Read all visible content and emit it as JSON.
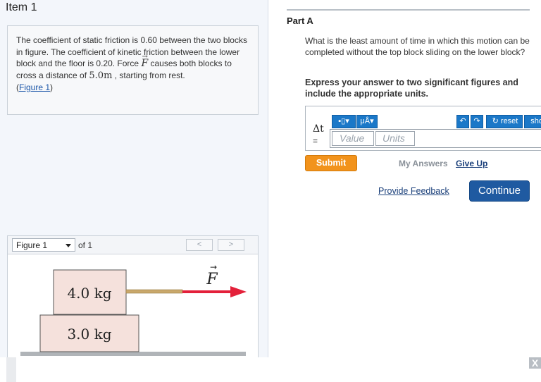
{
  "item": {
    "title": "Item 1"
  },
  "problem": {
    "text1": "The coefficient of static friction is 0.60 between the two blocks in figure. The coefficient of kinetic friction between the lower block and the floor is 0.20. Force ",
    "force_symbol": "F",
    "text2": " causes both blocks to cross a distance of ",
    "distance": "5.0m",
    "text3": " , starting from rest.",
    "figure_link": "Figure 1",
    "link_open": "(",
    "link_close": ")"
  },
  "figure_panel": {
    "select_value": "Figure 1",
    "of_text": "of 1",
    "prev": "<",
    "next": ">"
  },
  "figure": {
    "top_block": "4.0 kg",
    "bottom_block": "3.0 kg",
    "force_label": "F"
  },
  "part": {
    "title": "Part A",
    "question": "What is the least amount of time in which this motion can be completed without the top block sliding on the lower block?",
    "instruction": "Express your answer to two significant figures and include the appropriate units."
  },
  "answer": {
    "variable": "Δt",
    "equals": "=",
    "value_placeholder": "Value",
    "units_placeholder": "Units",
    "toolbar": {
      "templates_icon": "▪▯",
      "units_label": "μÅ",
      "undo": "↶",
      "redo": "↷",
      "reset_label": "reset",
      "show_label": "shor"
    }
  },
  "actions": {
    "submit": "Submit",
    "my_answers": "My Answers",
    "give_up": "Give Up",
    "feedback": "Provide Feedback",
    "continue": "Continue"
  },
  "window": {
    "close": "X"
  },
  "colors": {
    "arrow": "#e3203a",
    "block_fill": "#f5e1dc",
    "floor": "#b0b4b8",
    "rope": "#c9a86b",
    "accent": "#1f5aa1",
    "submit": "#f2931c"
  }
}
